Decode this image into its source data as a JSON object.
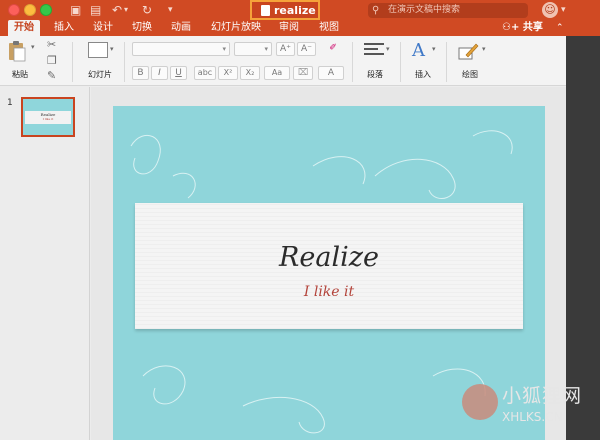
{
  "window": {
    "title": "realize"
  },
  "search": {
    "placeholder": "在演示文稿中搜索"
  },
  "tabs": [
    {
      "label": "开始"
    },
    {
      "label": "插入"
    },
    {
      "label": "设计"
    },
    {
      "label": "切换"
    },
    {
      "label": "动画"
    },
    {
      "label": "幻灯片放映"
    },
    {
      "label": "审阅"
    },
    {
      "label": "视图"
    }
  ],
  "share": {
    "label": "共享"
  },
  "ribbon": {
    "paste_label": "粘贴",
    "slide_label": "幻灯片",
    "paragraph_label": "段落",
    "insert_label": "插入",
    "draw_label": "绘图",
    "format_buttons": [
      "B",
      "I",
      "U",
      "abc",
      "X²",
      "X₂",
      "Aa",
      "A"
    ]
  },
  "thumbnails": [
    {
      "number": "1",
      "title": "Realize",
      "subtitle": "I like it"
    }
  ],
  "slide": {
    "title": "Realize",
    "subtitle": "I  like it",
    "background_color": "#8fd5da",
    "subtitle_color": "#b3433a"
  },
  "watermark": {
    "text_cn": "小狐狸网",
    "text_en": "XHLKS.CN"
  },
  "colors": {
    "accent": "#d04a23",
    "highlight_box": "#f5a23a"
  }
}
